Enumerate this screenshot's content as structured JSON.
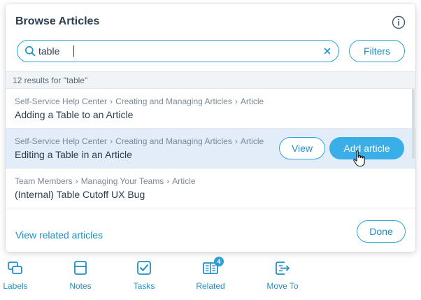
{
  "panel": {
    "title": "Browse Articles",
    "info_icon": "info-circle-icon"
  },
  "search": {
    "value": "table",
    "icon": "search-icon",
    "clear_icon": "clear-x-icon",
    "filters_label": "Filters"
  },
  "results_count": "12 results for \"table\"",
  "results": [
    {
      "crumbs": [
        "Self-Service Help Center",
        "Creating and Managing Articles",
        "Article"
      ],
      "title": "Adding a Table to an Article"
    },
    {
      "crumbs": [
        "Self-Service Help Center",
        "Creating and Managing Articles",
        "Article"
      ],
      "title": "Editing a Table in an Article",
      "view_label": "View",
      "add_label": "Add article"
    },
    {
      "crumbs": [
        "Team Members",
        "Managing Your Teams",
        "Article"
      ],
      "title": "(Internal) Table Cutoff UX Bug"
    }
  ],
  "crumb_separator": "›",
  "footer": {
    "related_link": "View related articles",
    "done_label": "Done"
  },
  "bottom_nav": [
    {
      "label": "Labels",
      "icon": "labels-icon"
    },
    {
      "label": "Notes",
      "icon": "notes-icon"
    },
    {
      "label": "Tasks",
      "icon": "tasks-icon"
    },
    {
      "label": "Related",
      "icon": "related-icon",
      "badge": "4"
    },
    {
      "label": "Move To",
      "icon": "move-to-icon"
    }
  ],
  "colors": {
    "accent": "#2aa5d8",
    "link": "#1e8fc6",
    "primary_button": "#3aaee6",
    "highlight_row": "#e2edf9"
  }
}
